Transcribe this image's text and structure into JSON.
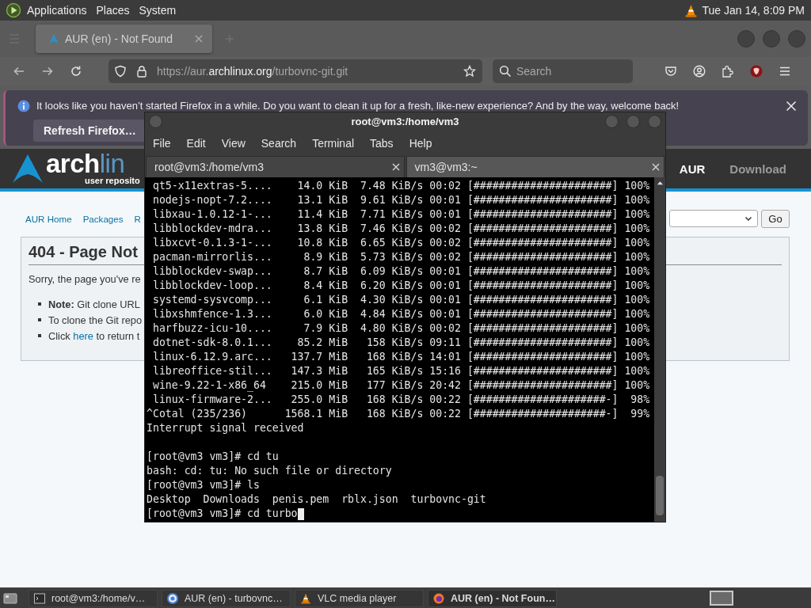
{
  "top_panel": {
    "menus": [
      "Applications",
      "Places",
      "System"
    ],
    "clock": "Tue Jan 14, 8:09 PM"
  },
  "browser": {
    "tabs": [
      {
        "title": "AUR (en) - Not Found",
        "selected": true
      }
    ],
    "url": "https://aur.**archlinux.org**/turbovnc-git.git",
    "search": {
      "placeholder": "Search"
    },
    "notification": {
      "message": "It looks like you haven’t started Firefox in a while. Do you want to clean it up for a fresh, like-new experience? And by the way, welcome back!",
      "button": "Refresh Firefox…"
    }
  },
  "page": {
    "logo": {
      "word": "arch",
      "word_light": "lin",
      "tagline": "user reposito"
    },
    "header_links": [
      {
        "label": "AUR",
        "selected": true
      },
      {
        "label": "Download",
        "selected": false
      }
    ],
    "nav_links": [
      "AUR Home",
      "Packages",
      "R"
    ],
    "go_button": "Go",
    "heading": "404 - Page Not",
    "message": "Sorry, the page you've re",
    "notes": [
      {
        "kind": "text",
        "text": "**Note:** Git clone URL"
      },
      {
        "kind": "text",
        "text": "To clone the Git repo"
      },
      {
        "kind": "link",
        "before": "Click",
        "link": "here",
        "after": "to return t"
      }
    ]
  },
  "terminal": {
    "title": "root@vm3:/home/vm3",
    "menu": [
      "File",
      "Edit",
      "View",
      "Search",
      "Terminal",
      "Tabs",
      "Help"
    ],
    "tabs": [
      {
        "title": "root@vm3:/home/vm3",
        "selected": true
      },
      {
        "title": "vm3@vm3:~",
        "selected": false
      }
    ],
    "lines": [
      {
        "kind": "output",
        "text": " qt5-x11extras-5....    14.0 KiB  7.48 KiB/s 00:02 [######################] 100%",
        "cursor": false
      },
      {
        "kind": "output",
        "text": " nodejs-nopt-7.2....    13.1 KiB  9.61 KiB/s 00:01 [######################] 100%",
        "cursor": false
      },
      {
        "kind": "output",
        "text": " libxau-1.0.12-1-...    11.4 KiB  7.71 KiB/s 00:01 [######################] 100%",
        "cursor": false
      },
      {
        "kind": "output",
        "text": " libblockdev-mdra...    13.8 KiB  7.46 KiB/s 00:02 [######################] 100%",
        "cursor": false
      },
      {
        "kind": "output",
        "text": " libxcvt-0.1.3-1-...    10.8 KiB  6.65 KiB/s 00:02 [######################] 100%",
        "cursor": false
      },
      {
        "kind": "output",
        "text": " pacman-mirrorlis...     8.9 KiB  5.73 KiB/s 00:02 [######################] 100%",
        "cursor": false
      },
      {
        "kind": "output",
        "text": " libblockdev-swap...     8.7 KiB  6.09 KiB/s 00:01 [######################] 100%",
        "cursor": false
      },
      {
        "kind": "output",
        "text": " libblockdev-loop...     8.4 KiB  6.20 KiB/s 00:01 [######################] 100%",
        "cursor": false
      },
      {
        "kind": "output",
        "text": " systemd-sysvcomp...     6.1 KiB  4.30 KiB/s 00:01 [######################] 100%",
        "cursor": false
      },
      {
        "kind": "output",
        "text": " libxshmfence-1.3...     6.0 KiB  4.84 KiB/s 00:01 [######################] 100%",
        "cursor": false
      },
      {
        "kind": "output",
        "text": " harfbuzz-icu-10....     7.9 KiB  4.80 KiB/s 00:02 [######################] 100%",
        "cursor": false
      },
      {
        "kind": "output",
        "text": " dotnet-sdk-8.0.1...    85.2 MiB   158 KiB/s 09:11 [######################] 100%",
        "cursor": false
      },
      {
        "kind": "output",
        "text": " linux-6.12.9.arc...   137.7 MiB   168 KiB/s 14:01 [######################] 100%",
        "cursor": false
      },
      {
        "kind": "output",
        "text": " libreoffice-stil...   147.3 MiB   165 KiB/s 15:16 [######################] 100%",
        "cursor": false
      },
      {
        "kind": "output",
        "text": " wine-9.22-1-x86_64    215.0 MiB   177 KiB/s 20:42 [######################] 100%",
        "cursor": false
      },
      {
        "kind": "output",
        "text": " linux-firmware-2...   255.0 MiB   168 KiB/s 00:22 [#####################-]  98%",
        "cursor": false
      },
      {
        "kind": "output",
        "text": "^Cotal (235/236)      1568.1 MiB   168 KiB/s 00:22 [#####################-]  99%",
        "cursor": false
      },
      {
        "kind": "output",
        "text": "Interrupt signal received",
        "cursor": false
      },
      {
        "kind": "blank",
        "cursor": false
      },
      {
        "kind": "output",
        "text": "[root@vm3 vm3]# cd tu",
        "cursor": false
      },
      {
        "kind": "output",
        "text": "bash: cd: tu: No such file or directory",
        "cursor": false
      },
      {
        "kind": "output",
        "text": "[root@vm3 vm3]# ls",
        "cursor": false
      },
      {
        "kind": "output",
        "text": "Desktop  Downloads  penis.pem  rblx.json  turbovnc-git",
        "cursor": false
      },
      {
        "kind": "output",
        "text": "[root@vm3 vm3]# cd turbo",
        "cursor": true
      }
    ]
  },
  "taskbar": {
    "tasks": [
      {
        "kind": "terminal",
        "title": "root@vm3:/home/v…",
        "selected": false
      },
      {
        "kind": "ring",
        "title": "AUR (en) - turbovnc…",
        "selected": false
      },
      {
        "kind": "cone",
        "title": "VLC media player",
        "selected": false
      },
      {
        "kind": "orb",
        "title": "AUR (en) - Not Foun…",
        "selected": true
      }
    ]
  }
}
